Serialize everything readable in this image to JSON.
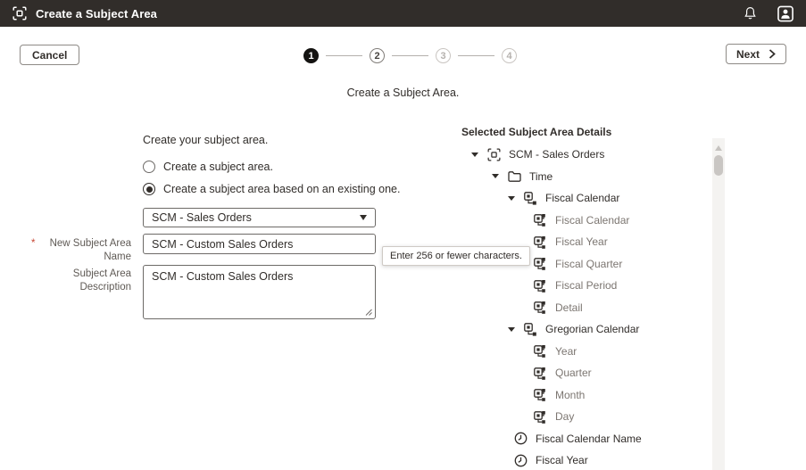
{
  "header": {
    "title": "Create a Subject Area"
  },
  "toolbar": {
    "cancel_label": "Cancel",
    "next_label": "Next"
  },
  "stepper": {
    "current_step": 1,
    "steps": [
      {
        "label": "1",
        "state": "current"
      },
      {
        "label": "2",
        "state": "next"
      },
      {
        "label": "3",
        "state": "future"
      },
      {
        "label": "4",
        "state": "future"
      }
    ]
  },
  "subtitle": "Create a Subject Area.",
  "form": {
    "heading": "Create your subject area.",
    "radio_options": [
      {
        "label": "Create a subject area.",
        "selected": false
      },
      {
        "label": "Create a subject area based on an existing one.",
        "selected": true
      }
    ],
    "source_dropdown": {
      "value": "SCM - Sales Orders"
    },
    "name_field": {
      "required_marker": "*",
      "label": "New Subject Area Name",
      "value": "SCM - Custom Sales Orders"
    },
    "tooltip": "Enter 256 or fewer characters.",
    "description_field": {
      "label": "Subject Area Description",
      "value": "SCM - Custom Sales Orders"
    }
  },
  "details_panel": {
    "title": "Selected Subject Area Details",
    "tree": [
      {
        "label": "SCM - Sales Orders",
        "icon": "subject-area-icon",
        "level": "0",
        "caret": true,
        "muted": false
      },
      {
        "label": "Time",
        "icon": "folder-icon",
        "level": "1",
        "caret": true,
        "muted": false
      },
      {
        "label": "Fiscal Calendar",
        "icon": "hierarchy-icon",
        "level": "2",
        "caret": true,
        "muted": false
      },
      {
        "label": "Fiscal Calendar",
        "icon": "level-icon",
        "level": "leaf",
        "caret": false,
        "muted": true
      },
      {
        "label": "Fiscal Year",
        "icon": "level-icon",
        "level": "leaf",
        "caret": false,
        "muted": true
      },
      {
        "label": "Fiscal Quarter",
        "icon": "level-icon",
        "level": "leaf",
        "caret": false,
        "muted": true
      },
      {
        "label": "Fiscal Period",
        "icon": "level-icon",
        "level": "leaf",
        "caret": false,
        "muted": true
      },
      {
        "label": "Detail",
        "icon": "level-icon",
        "level": "leaf",
        "caret": false,
        "muted": true
      },
      {
        "label": "Gregorian Calendar",
        "icon": "hierarchy-icon",
        "level": "2",
        "caret": true,
        "muted": false
      },
      {
        "label": "Year",
        "icon": "level-icon",
        "level": "leaf",
        "caret": false,
        "muted": true
      },
      {
        "label": "Quarter",
        "icon": "level-icon",
        "level": "leaf",
        "caret": false,
        "muted": true
      },
      {
        "label": "Month",
        "icon": "level-icon",
        "level": "leaf",
        "caret": false,
        "muted": true
      },
      {
        "label": "Day",
        "icon": "level-icon",
        "level": "leaf",
        "caret": false,
        "muted": true
      },
      {
        "label": "Fiscal Calendar Name",
        "icon": "clock-icon",
        "level": "attr",
        "caret": false,
        "muted": false
      },
      {
        "label": "Fiscal Year",
        "icon": "clock-icon",
        "level": "attr",
        "caret": false,
        "muted": false
      }
    ]
  },
  "colors": {
    "header_bg": "#312d2a",
    "text_dark": "#312d2a",
    "text_muted": "#7c7671",
    "required_marker": "#c74634",
    "step_current_bg": "#141311",
    "border_input": "#6d6a67"
  }
}
